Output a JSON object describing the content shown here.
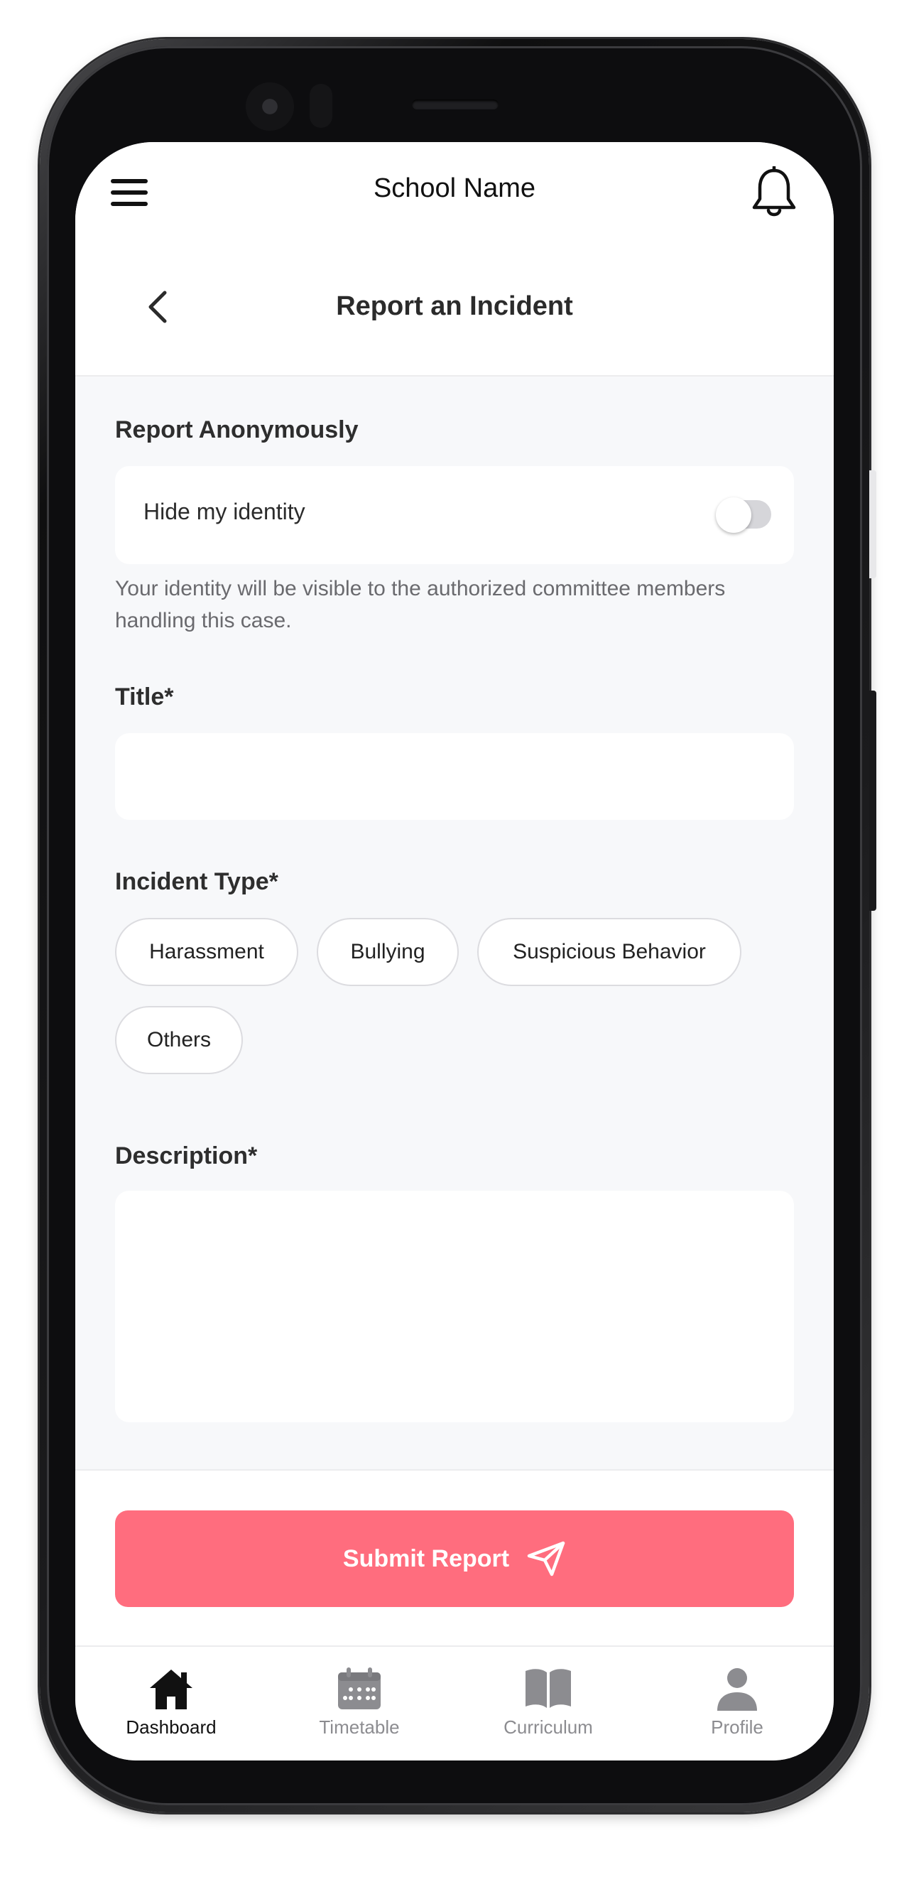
{
  "header": {
    "school_name": "School Name",
    "page_title": "Report an Incident"
  },
  "anonymous": {
    "section_label": "Report Anonymously",
    "toggle_label": "Hide my identity",
    "toggle_on": false,
    "helper_text": "Your identity will be visible to the authorized committee members handling this case."
  },
  "form": {
    "title_label": "Title*",
    "title_value": "",
    "incident_type_label": "Incident Type*",
    "incident_types": [
      "Harassment",
      "Bullying",
      "Suspicious Behavior",
      "Others"
    ],
    "description_label": "Description*",
    "description_value": ""
  },
  "submit": {
    "label": "Submit Report",
    "icon": "send-icon",
    "color": "#ff6d7e"
  },
  "nav": {
    "items": [
      {
        "label": "Dashboard",
        "icon": "home-icon",
        "active": true
      },
      {
        "label": "Timetable",
        "icon": "calendar-icon",
        "active": false
      },
      {
        "label": "Curriculum",
        "icon": "book-icon",
        "active": false
      },
      {
        "label": "Profile",
        "icon": "user-icon",
        "active": false
      }
    ]
  },
  "colors": {
    "accent": "#ff6d7e",
    "background": "#f7f8fa",
    "active_nav": "#111111",
    "inactive_nav": "#8c8c90"
  }
}
